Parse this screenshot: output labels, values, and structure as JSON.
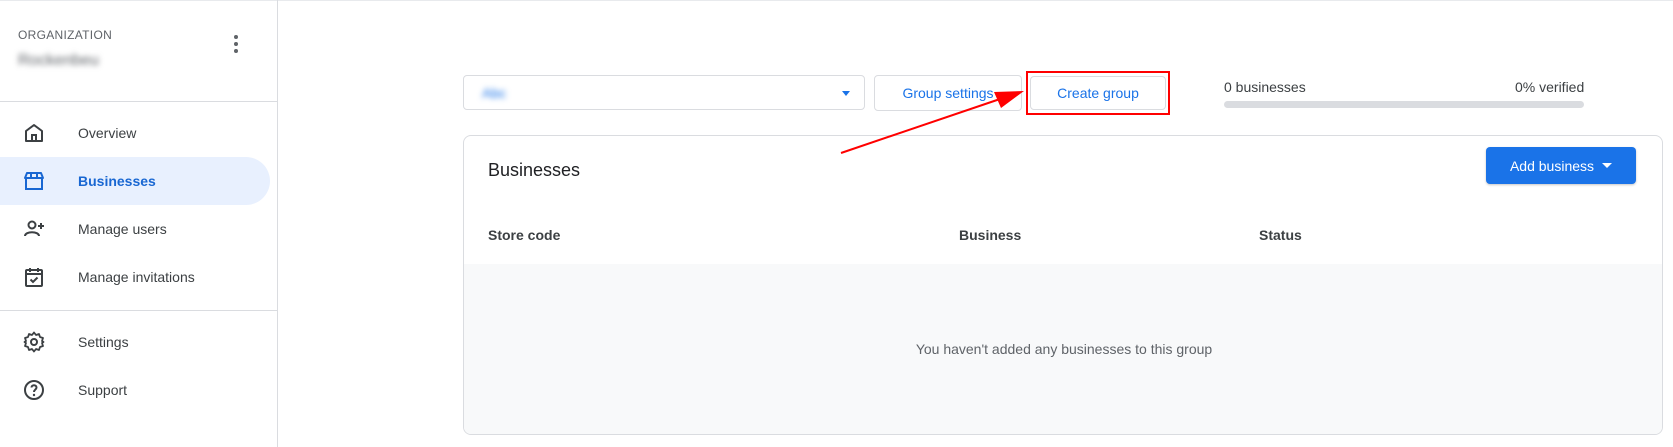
{
  "sidebar": {
    "org_label": "ORGANIZATION",
    "org_name": "Rockenbeu",
    "items": [
      {
        "label": "Overview",
        "icon": "home-icon"
      },
      {
        "label": "Businesses",
        "icon": "storefront-icon",
        "active": true
      },
      {
        "label": "Manage users",
        "icon": "person-add-icon"
      },
      {
        "label": "Manage invitations",
        "icon": "event-available-icon"
      },
      {
        "label": "Settings",
        "icon": "gear-icon"
      },
      {
        "label": "Support",
        "icon": "help-icon"
      }
    ]
  },
  "toolbar": {
    "group_select_value": "Abc",
    "group_settings_label": "Group settings",
    "create_group_label": "Create group"
  },
  "stats": {
    "businesses_count": "0 businesses",
    "verified": "0% verified",
    "verified_fraction": 0
  },
  "card": {
    "title": "Businesses",
    "add_button_label": "Add business",
    "columns": [
      "Store code",
      "Business",
      "Status"
    ],
    "empty_message": "You haven't added any businesses to this group"
  },
  "colors": {
    "accent": "#1a73e8",
    "active_nav_bg": "#e8f0fe",
    "annotation": "#ff0000"
  }
}
